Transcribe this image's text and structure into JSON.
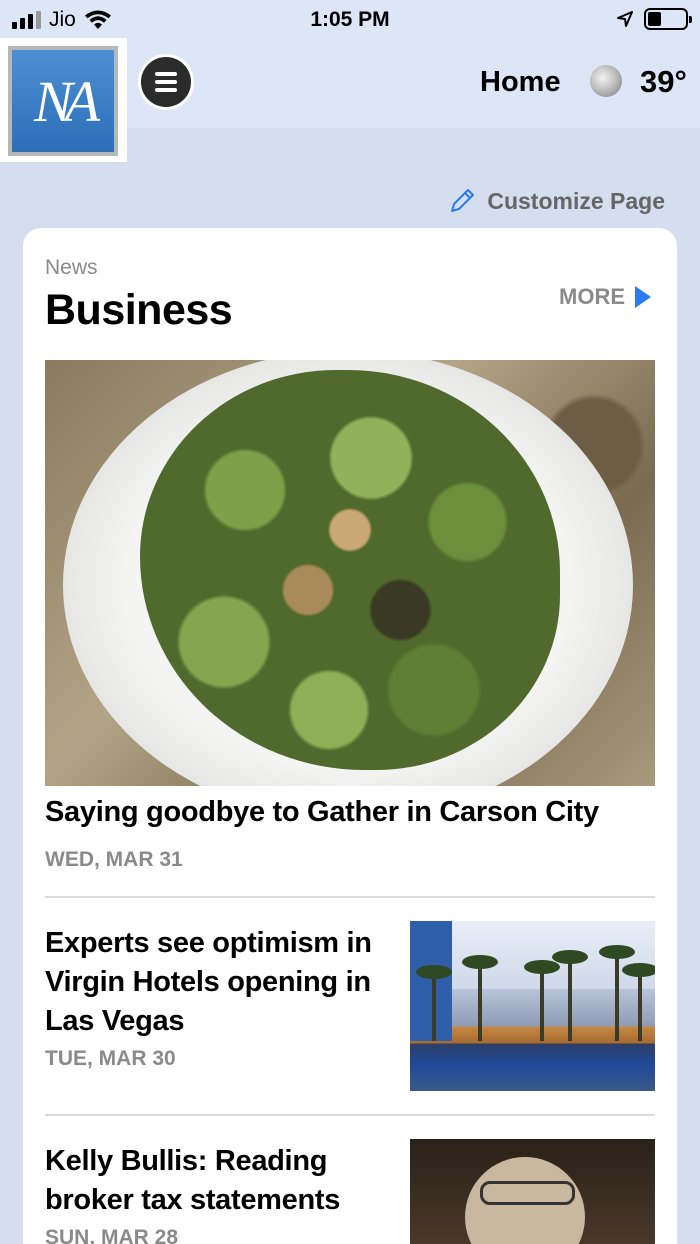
{
  "status_bar": {
    "carrier": "Jio",
    "time": "1:05 PM"
  },
  "header": {
    "logo_text": "NA",
    "home_label": "Home",
    "temperature": "39°",
    "weather_icon": "moon-icon"
  },
  "customize": {
    "label": "Customize Page"
  },
  "section": {
    "kicker": "News",
    "title": "Business",
    "more_label": "MORE"
  },
  "stories": [
    {
      "title": "Saying goodbye to Gather in Carson City",
      "date": "WED, MAR 31"
    },
    {
      "title": "Experts see optimism in Virgin Hotels opening in Las Vegas",
      "date": "TUE, MAR 30"
    },
    {
      "title": "Kelly Bullis: Reading broker tax statements",
      "date": "SUN, MAR 28"
    }
  ],
  "colors": {
    "accent": "#2a7cf0",
    "page_bg": "#d4deef",
    "header_bg": "#dde6f6"
  }
}
